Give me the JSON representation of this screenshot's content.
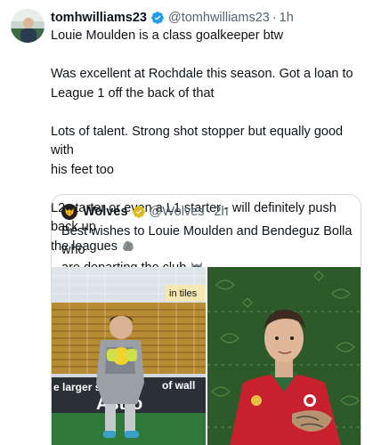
{
  "tweet": {
    "author_name": "tomhwilliams23",
    "handle": "@tomhwilliams23",
    "separator": "·",
    "time": "1h",
    "lines": [
      "Louie Moulden is a class goalkeeper btw",
      "",
      "Was excellent at Rochdale this season. Got a loan to",
      "League 1 off the back of that",
      "",
      "Lots of talent. Strong shot stopper but equally good with",
      "his feet too",
      "",
      "L2 starter or even a L1 starter - will definitely push back up",
      "the leagues"
    ],
    "trailing_emoji": "rock-emoji"
  },
  "quote": {
    "author_name": "Wolves",
    "handle": "@Wolves",
    "separator": "·",
    "time": "2h",
    "line1": "Best wishes to Louie Moulden and Bendeguz Bolla who",
    "line2": "are departing the club",
    "trailing_emoji": "wolf-emoji",
    "image1_banner_a": "in tiles",
    "image1_banner_b": "e larger s",
    "image1_banner_c": "of wall",
    "image1_banner_d": "Astro"
  },
  "colors": {
    "verified_blue": "#1d9bf0",
    "verified_gold": "#e2b719",
    "text": "#0f1419",
    "muted": "#536471",
    "border": "#cfd9de"
  }
}
